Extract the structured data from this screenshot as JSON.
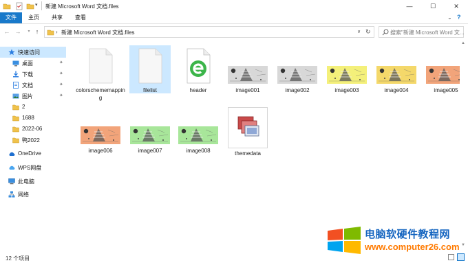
{
  "window": {
    "title": "新建 Microsoft Word 文档.files",
    "controls": {
      "minimize": "—",
      "maximize": "☐",
      "close": "✕"
    }
  },
  "ribbon": {
    "tabs": [
      "文件",
      "主页",
      "共享",
      "查看"
    ]
  },
  "address": {
    "path_sep": "›",
    "path": "新建 Microsoft Word 文档.files",
    "search_placeholder": "搜索\"新建 Microsoft Word 文..."
  },
  "sidebar": {
    "items": [
      {
        "label": "快速访问",
        "icon": "star-icon",
        "pinned": false,
        "selected": true
      },
      {
        "label": "桌面",
        "icon": "desktop-icon",
        "pinned": true
      },
      {
        "label": "下载",
        "icon": "download-icon",
        "pinned": true
      },
      {
        "label": "文档",
        "icon": "document-icon",
        "pinned": true
      },
      {
        "label": "图片",
        "icon": "picture-icon",
        "pinned": true
      },
      {
        "label": "2",
        "icon": "folder-icon",
        "pinned": false
      },
      {
        "label": "1688",
        "icon": "folder-icon",
        "pinned": false
      },
      {
        "label": "2022-06",
        "icon": "folder-icon",
        "pinned": false
      },
      {
        "label": "鸭2022",
        "icon": "folder-icon",
        "pinned": false
      },
      {
        "label": "OneDrive",
        "icon": "cloud-icon",
        "pinned": false
      },
      {
        "label": "WPS网盘",
        "icon": "wps-cloud-icon",
        "pinned": false
      },
      {
        "label": "此电脑",
        "icon": "computer-icon",
        "pinned": false
      },
      {
        "label": "网络",
        "icon": "network-icon",
        "pinned": false
      }
    ]
  },
  "files": [
    {
      "name": "colorschememapping",
      "name_display": "colorschememapping",
      "kind": "blank"
    },
    {
      "name": "filelist",
      "kind": "blank",
      "selected": true
    },
    {
      "name": "header",
      "kind": "html"
    },
    {
      "name": "image001",
      "kind": "image",
      "tint": "#d8d8d8"
    },
    {
      "name": "image002",
      "kind": "image",
      "tint": "#d8d8d8"
    },
    {
      "name": "image003",
      "kind": "image",
      "tint": "#f4f07a"
    },
    {
      "name": "image004",
      "kind": "image",
      "tint": "#f4d86a"
    },
    {
      "name": "image005",
      "kind": "image",
      "tint": "#f2a47a"
    },
    {
      "name": "image006",
      "kind": "image",
      "tint": "#f2a47a"
    },
    {
      "name": "image007",
      "kind": "image",
      "tint": "#a8e69a"
    },
    {
      "name": "image008",
      "kind": "image",
      "tint": "#a8e69a"
    },
    {
      "name": "themedata",
      "kind": "theme"
    }
  ],
  "status": {
    "count": "12 个项目"
  },
  "watermark": {
    "title": "电脑软硬件教程网",
    "url": "www.computer26.com",
    "colors": [
      "#f25022",
      "#7fba00",
      "#00a4ef",
      "#ffb900"
    ]
  },
  "colors": {
    "accent": "#1979ca",
    "selection": "#cce8ff"
  }
}
